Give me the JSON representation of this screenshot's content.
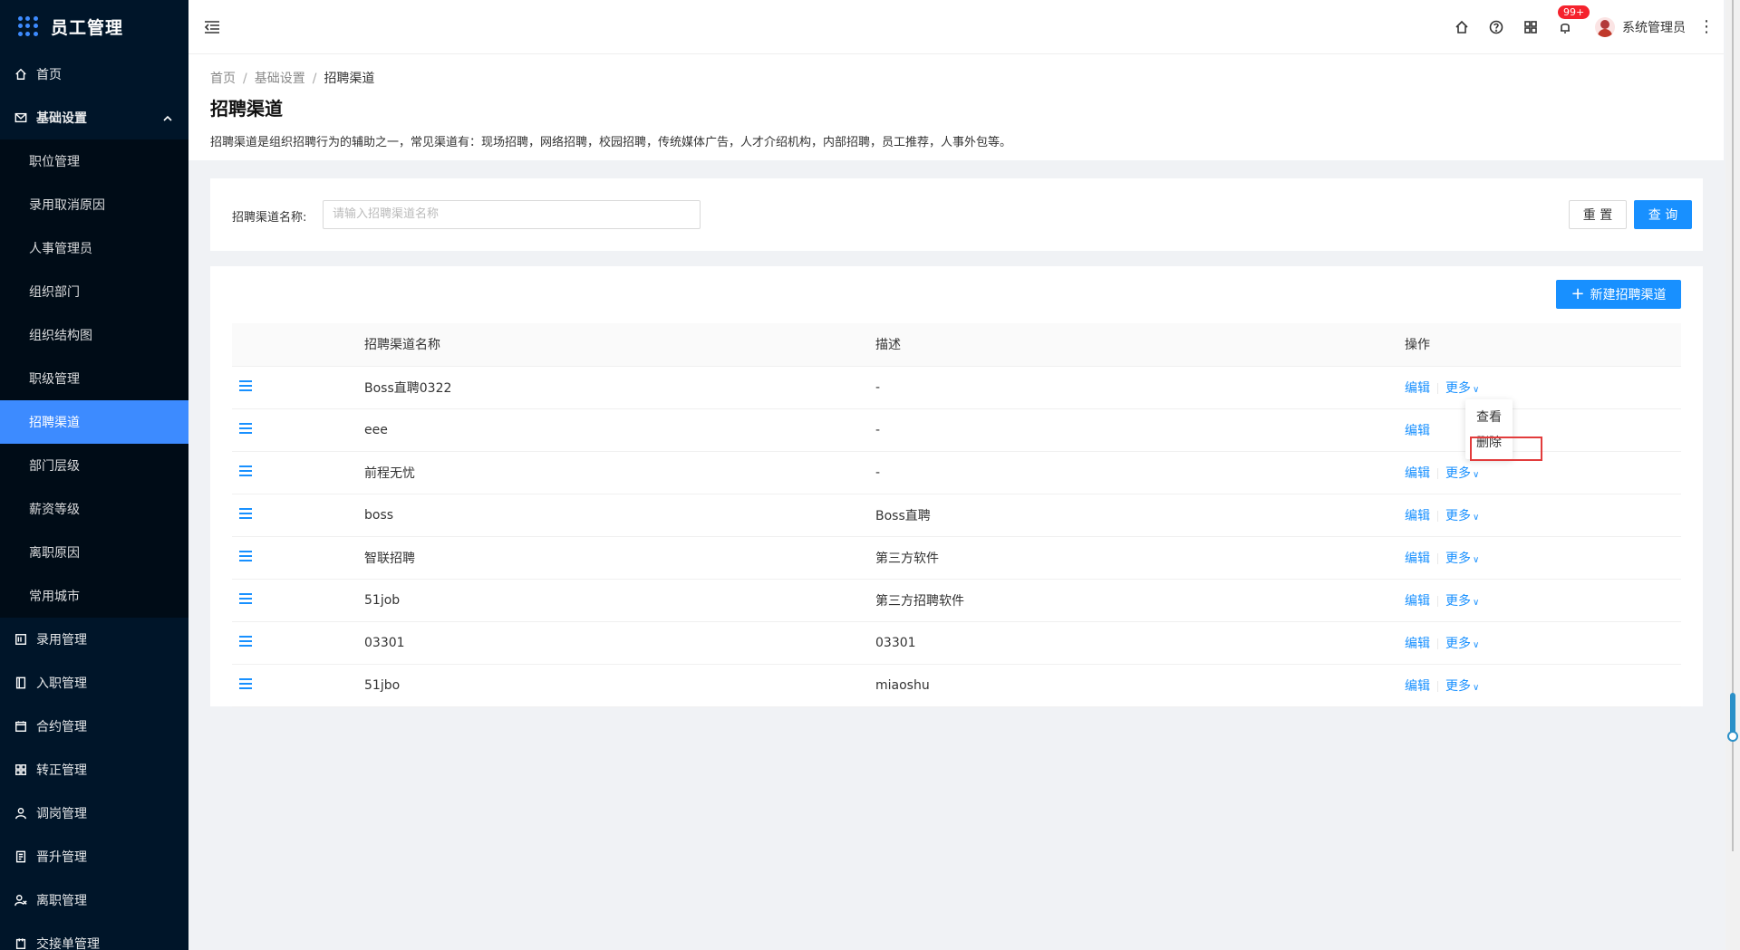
{
  "app": {
    "title": "员工管理"
  },
  "sidebar": {
    "items": [
      {
        "label": "首页",
        "icon": "home-icon"
      },
      {
        "label": "基础设置",
        "icon": "mail-icon"
      },
      {
        "label": "录用管理",
        "icon": "hire-icon"
      },
      {
        "label": "入职管理",
        "icon": "book-icon"
      },
      {
        "label": "合约管理",
        "icon": "calendar-icon"
      },
      {
        "label": "转正管理",
        "icon": "grid-icon"
      },
      {
        "label": "调岗管理",
        "icon": "user-icon"
      },
      {
        "label": "晋升管理",
        "icon": "doc-icon"
      },
      {
        "label": "离职管理",
        "icon": "leave-icon"
      },
      {
        "label": "交接单管理",
        "icon": "handover-icon"
      }
    ],
    "sub_items": [
      "职位管理",
      "录用取消原因",
      "人事管理员",
      "组织部门",
      "组织结构图",
      "职级管理",
      "招聘渠道",
      "部门层级",
      "薪资等级",
      "离职原因",
      "常用城市"
    ]
  },
  "header": {
    "badge": "99+",
    "user_name": "系统管理员"
  },
  "breadcrumb": [
    "首页",
    "基础设置",
    "招聘渠道"
  ],
  "page": {
    "title": "招聘渠道",
    "description": "招聘渠道是组织招聘行为的辅助之一，常见渠道有：现场招聘，网络招聘，校园招聘，传统媒体广告，人才介绍机构，内部招聘，员工推荐，人事外包等。"
  },
  "search": {
    "label": "招聘渠道名称:",
    "placeholder": "请输入招聘渠道名称",
    "reset_label": "重 置",
    "query_label": "查 询"
  },
  "table": {
    "new_button": "新建招聘渠道",
    "columns": [
      "招聘渠道名称",
      "描述",
      "操作"
    ],
    "edit_label": "编辑",
    "more_label": "更多",
    "rows": [
      {
        "name": "Boss直聘0322",
        "desc": "-"
      },
      {
        "name": "eee",
        "desc": "-"
      },
      {
        "name": "前程无忧",
        "desc": "-"
      },
      {
        "name": "boss",
        "desc": "Boss直聘"
      },
      {
        "name": "智联招聘",
        "desc": "第三方软件"
      },
      {
        "name": "51job",
        "desc": "第三方招聘软件"
      },
      {
        "name": "03301",
        "desc": "03301"
      },
      {
        "name": "51jbo",
        "desc": "miaoshu"
      }
    ]
  },
  "dropdown": {
    "items": [
      "查看",
      "删除"
    ]
  },
  "colors": {
    "primary": "#1890ff",
    "sidebar_bg": "#001529",
    "active_bg": "#3d8bff",
    "highlight": "#e23c3c"
  }
}
